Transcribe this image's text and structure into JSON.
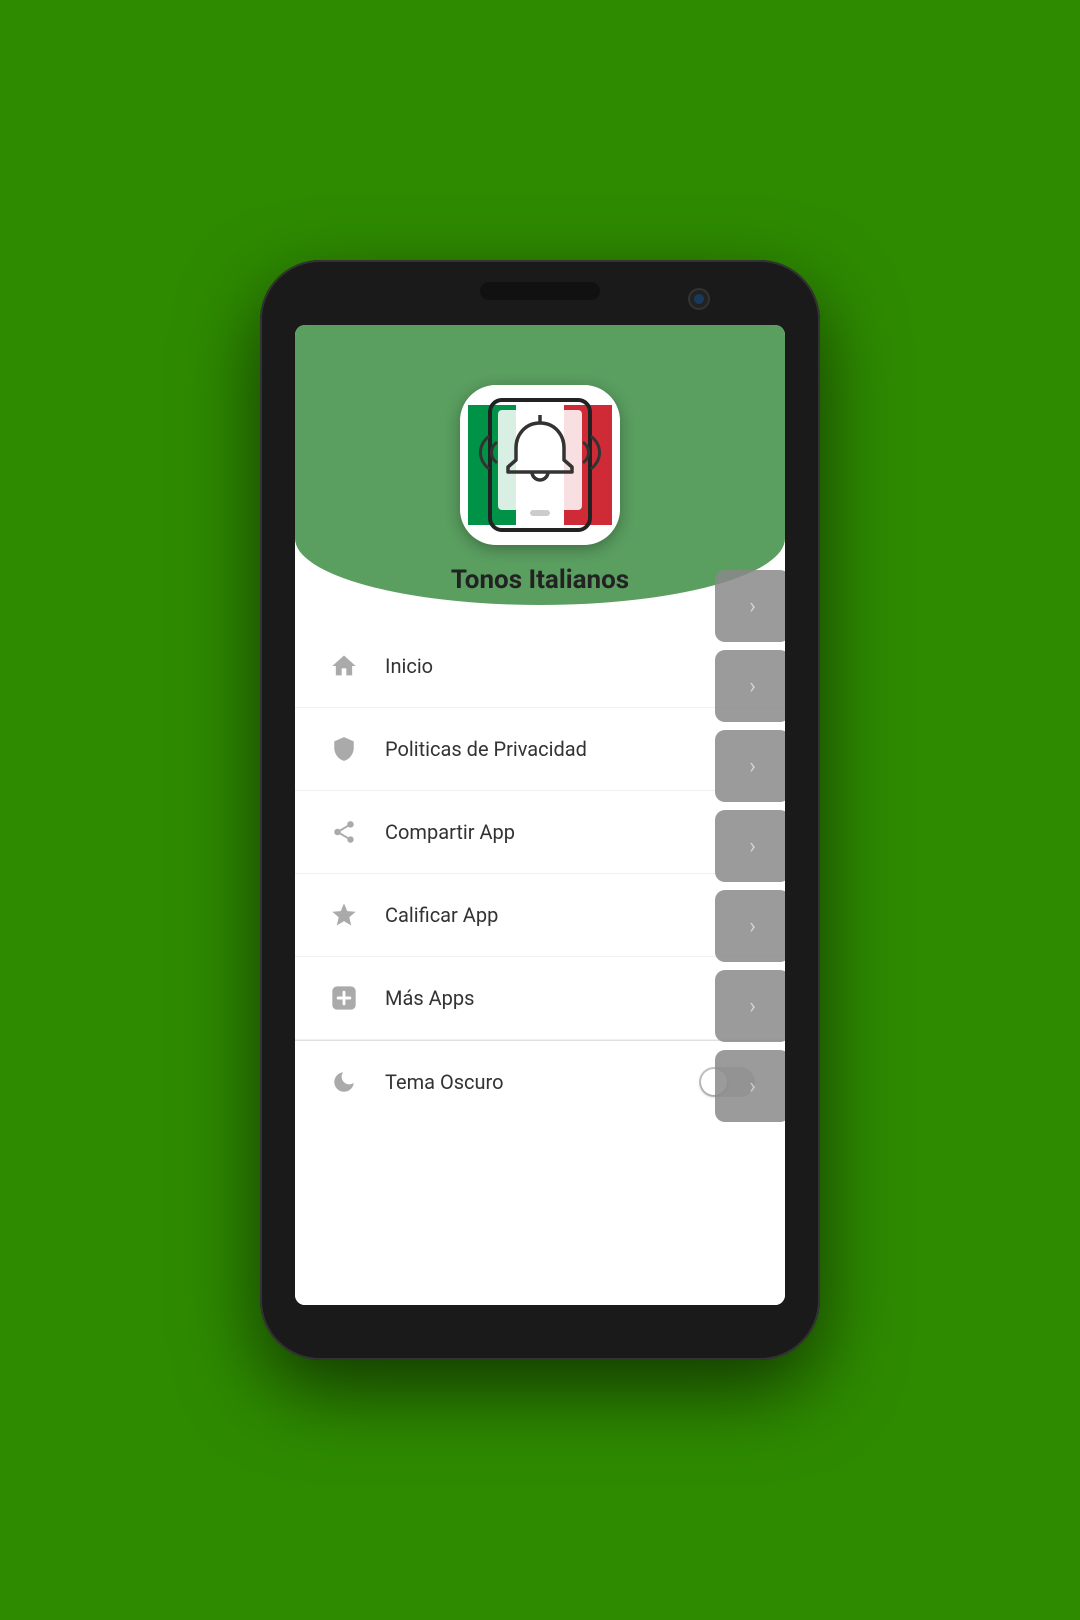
{
  "background_color": "#2e8b00",
  "app": {
    "title": "Tonos Italianos",
    "icon_alt": "app-icon"
  },
  "menu": {
    "items": [
      {
        "id": "inicio",
        "label": "Inicio",
        "icon": "home"
      },
      {
        "id": "privacidad",
        "label": "Politicas de Privacidad",
        "icon": "shield"
      },
      {
        "id": "compartir",
        "label": "Compartir App",
        "icon": "share"
      },
      {
        "id": "calificar",
        "label": "Calificar App",
        "icon": "star"
      },
      {
        "id": "mas-apps",
        "label": "Más Apps",
        "icon": "plus"
      }
    ],
    "dark_mode": {
      "label": "Tema Oscuro",
      "enabled": false,
      "icon": "moon"
    }
  },
  "right_panel": {
    "items": [
      {
        "chevron": "›"
      },
      {
        "chevron": "›"
      },
      {
        "chevron": "›"
      },
      {
        "chevron": "›"
      },
      {
        "chevron": "›"
      },
      {
        "chevron": "›"
      },
      {
        "chevron": "›"
      }
    ]
  }
}
